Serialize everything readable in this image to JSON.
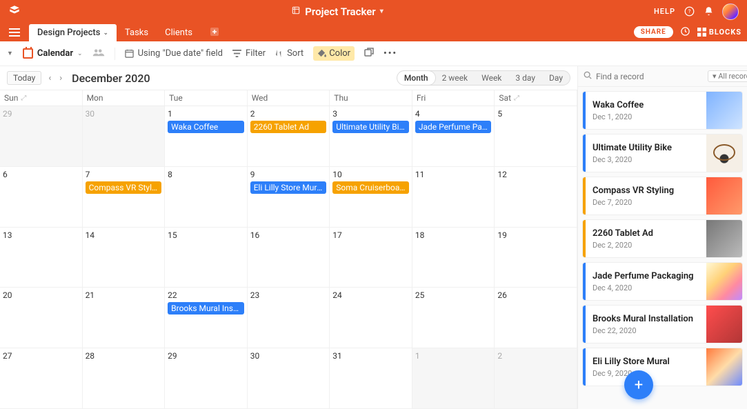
{
  "topbar": {
    "title": "Project Tracker",
    "help": "HELP"
  },
  "tabs": {
    "items": [
      {
        "label": "Design Projects"
      },
      {
        "label": "Tasks"
      },
      {
        "label": "Clients"
      }
    ],
    "share": "SHARE",
    "blocks": "BLOCKS"
  },
  "toolbar": {
    "view_name": "Calendar",
    "using": "Using \"Due date\" field",
    "filter": "Filter",
    "sort": "Sort",
    "color": "Color"
  },
  "calendar": {
    "today": "Today",
    "month_label": "December 2020",
    "views": [
      "Month",
      "2 week",
      "Week",
      "3 day",
      "Day"
    ],
    "active_view": "Month",
    "day_names": [
      "Sun",
      "Mon",
      "Tue",
      "Wed",
      "Thu",
      "Fri",
      "Sat"
    ],
    "cells": [
      {
        "n": "29",
        "out": true
      },
      {
        "n": "30",
        "out": true
      },
      {
        "n": "1",
        "events": [
          {
            "t": "Waka Coffee",
            "c": "blue"
          }
        ]
      },
      {
        "n": "2",
        "events": [
          {
            "t": "2260 Tablet Ad",
            "c": "orange"
          }
        ]
      },
      {
        "n": "3",
        "events": [
          {
            "t": "Ultimate Utility Bike",
            "c": "blue"
          }
        ]
      },
      {
        "n": "4",
        "events": [
          {
            "t": "Jade Perfume Pac…",
            "c": "blue"
          }
        ]
      },
      {
        "n": "5"
      },
      {
        "n": "6"
      },
      {
        "n": "7",
        "events": [
          {
            "t": "Compass VR Styli…",
            "c": "orange"
          }
        ]
      },
      {
        "n": "8"
      },
      {
        "n": "9",
        "events": [
          {
            "t": "Eli Lilly Store Mural",
            "c": "blue"
          }
        ]
      },
      {
        "n": "10",
        "events": [
          {
            "t": "Soma Cruiserboard",
            "c": "orange"
          }
        ]
      },
      {
        "n": "11"
      },
      {
        "n": "12"
      },
      {
        "n": "13"
      },
      {
        "n": "14"
      },
      {
        "n": "15"
      },
      {
        "n": "16"
      },
      {
        "n": "17"
      },
      {
        "n": "18"
      },
      {
        "n": "19"
      },
      {
        "n": "20"
      },
      {
        "n": "21"
      },
      {
        "n": "22",
        "events": [
          {
            "t": "Brooks Mural Inst…",
            "c": "blue"
          }
        ]
      },
      {
        "n": "23"
      },
      {
        "n": "24"
      },
      {
        "n": "25"
      },
      {
        "n": "26"
      },
      {
        "n": "27"
      },
      {
        "n": "28"
      },
      {
        "n": "29"
      },
      {
        "n": "30"
      },
      {
        "n": "31"
      },
      {
        "n": "1",
        "out": true
      },
      {
        "n": "2",
        "out": true
      }
    ]
  },
  "sidebar": {
    "placeholder": "Find a record",
    "all_records": "All records",
    "records": [
      {
        "title": "Waka Coffee",
        "date": "Dec 1, 2020",
        "bar": "blue",
        "thumb": "t1"
      },
      {
        "title": "Ultimate Utility Bike",
        "date": "Dec 3, 2020",
        "bar": "blue",
        "thumb": "t2"
      },
      {
        "title": "Compass VR Styling",
        "date": "Dec 7, 2020",
        "bar": "orange",
        "thumb": "t3"
      },
      {
        "title": "2260 Tablet Ad",
        "date": "Dec 2, 2020",
        "bar": "orange",
        "thumb": "t4"
      },
      {
        "title": "Jade Perfume Packaging",
        "date": "Dec 4, 2020",
        "bar": "blue",
        "thumb": "t5"
      },
      {
        "title": "Brooks Mural Installation",
        "date": "Dec 22, 2020",
        "bar": "blue",
        "thumb": "t6"
      },
      {
        "title": "Eli Lilly Store Mural",
        "date": "Dec 9, 2020",
        "bar": "blue",
        "thumb": "t7"
      }
    ]
  }
}
